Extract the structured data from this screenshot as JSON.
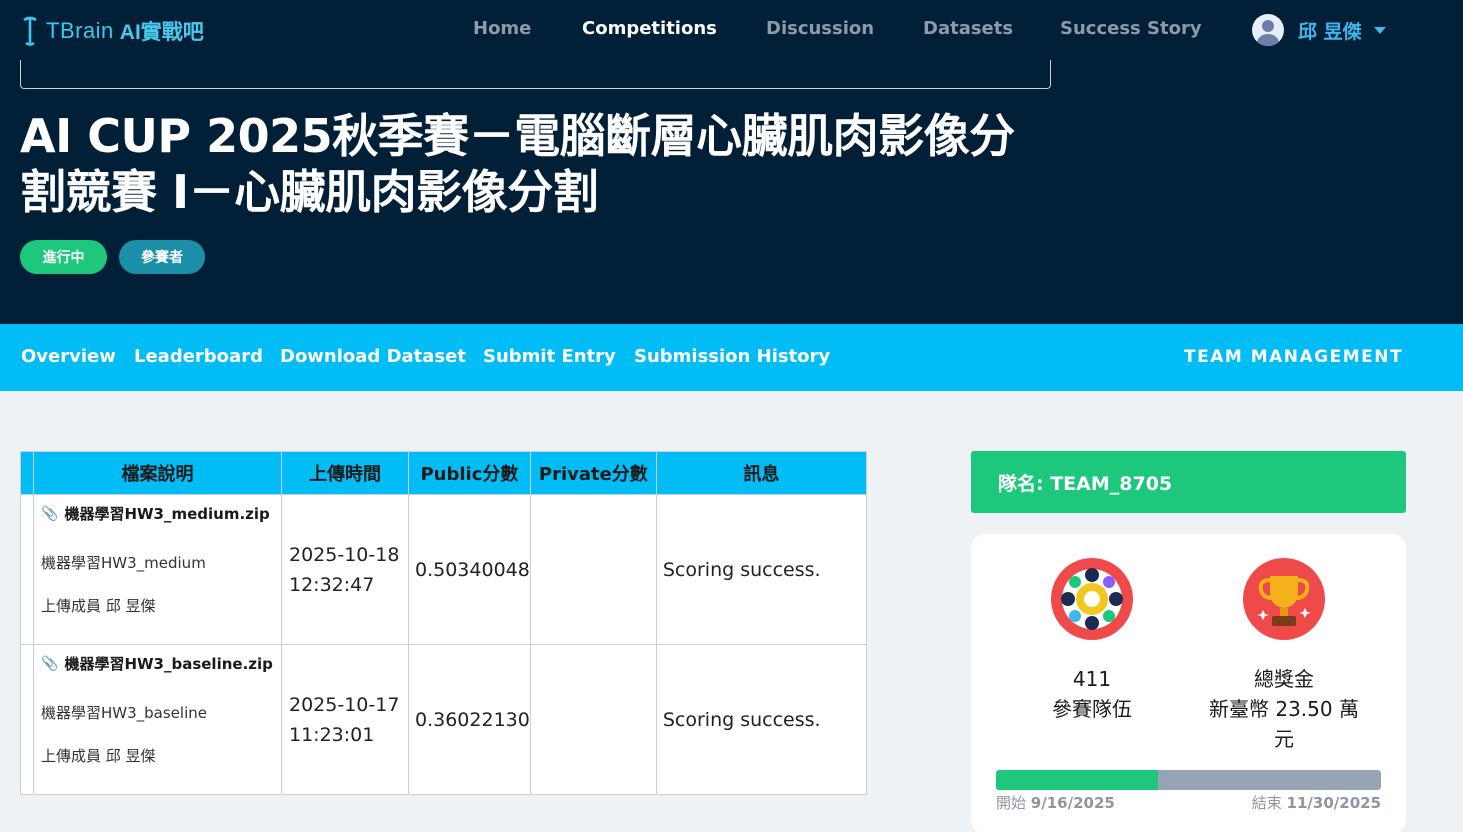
{
  "brand": {
    "logo_t": "TBrain",
    "logo_ai": "AI實戰吧"
  },
  "nav": {
    "items": [
      {
        "label": "Home",
        "active": false
      },
      {
        "label": "Competitions",
        "active": true
      },
      {
        "label": "Discussion",
        "active": false
      },
      {
        "label": "Datasets",
        "active": false
      },
      {
        "label": "Success Story",
        "active": false
      }
    ],
    "user_name": "邱 昱傑"
  },
  "competition": {
    "title": "AI CUP 2025秋季賽－電腦斷層心臟肌肉影像分割競賽 I－心臟肌肉影像分割",
    "badges": [
      "進行中",
      "參賽者"
    ]
  },
  "subnav": {
    "links": [
      "Overview",
      "Leaderboard",
      "Download Dataset",
      "Submit Entry",
      "Submission History"
    ],
    "team_management": "TEAM MANAGEMENT"
  },
  "table": {
    "headers": [
      "檔案說明",
      "上傳時間",
      "Public分數",
      "Private分數",
      "訊息"
    ],
    "rows": [
      {
        "file": "機器學習HW3_medium.zip",
        "desc": "機器學習HW3_medium",
        "uploader": "上傳成員 邱 昱傑",
        "date": "2025-10-18",
        "time": "12:32:47",
        "public": "0.50340048",
        "private": "",
        "message": "Scoring success."
      },
      {
        "file": "機器學習HW3_baseline.zip",
        "desc": "機器學習HW3_baseline",
        "uploader": "上傳成員 邱 昱傑",
        "date": "2025-10-17",
        "time": "11:23:01",
        "public": "0.36022130",
        "private": "",
        "message": "Scoring success."
      }
    ]
  },
  "team": {
    "label": "隊名: TEAM_8705"
  },
  "stats": {
    "teams_count": "411",
    "teams_label": "參賽隊伍",
    "prize_title": "總獎金",
    "prize_value": "新臺幣 23.50 萬",
    "prize_unit": "元"
  },
  "timeline": {
    "start_label": "開始",
    "start_date": "9/16/2025",
    "end_label": "結束",
    "end_date": "11/30/2025",
    "progress": 0.42
  },
  "colors": {
    "header_bg": "#021f38",
    "accent_blue": "#02bcf6",
    "success_green": "#1dc87c",
    "icon_red": "#ef4a4a"
  },
  "icons": {
    "attachment": "paperclip-icon",
    "teams": "team-circle-icon",
    "prize": "trophy-icon",
    "user": "avatar-icon",
    "dropdown": "caret-down-icon"
  }
}
